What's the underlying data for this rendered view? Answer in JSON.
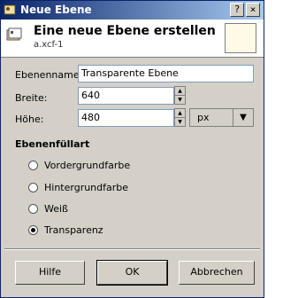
{
  "window": {
    "title": "Neue Ebene"
  },
  "titlebar": {
    "help_glyph": "?",
    "close_glyph": "×"
  },
  "header": {
    "title": "Eine neue Ebene erstellen",
    "subtitle": "a.xcf-1"
  },
  "form": {
    "name_label": "Ebenenname:",
    "name_value": "Transparente Ebene",
    "width_label": "Breite:",
    "width_value": "640",
    "height_label": "Höhe:",
    "height_value": "480",
    "unit_value": "px"
  },
  "fill": {
    "section_title": "Ebenenfüllart",
    "options": [
      {
        "label": "Vordergrundfarbe",
        "selected": false
      },
      {
        "label": "Hintergrundfarbe",
        "selected": false
      },
      {
        "label": "Weiß",
        "selected": false
      },
      {
        "label": "Transparenz",
        "selected": true
      }
    ]
  },
  "buttons": {
    "help": "Hilfe",
    "ok": "OK",
    "cancel": "Abbrechen"
  },
  "colors": {
    "titlebar_start": "#0a246a",
    "titlebar_end": "#a6caf0",
    "dialog_bg": "#d4d0c8",
    "preview_fill": "#fff9e8"
  }
}
